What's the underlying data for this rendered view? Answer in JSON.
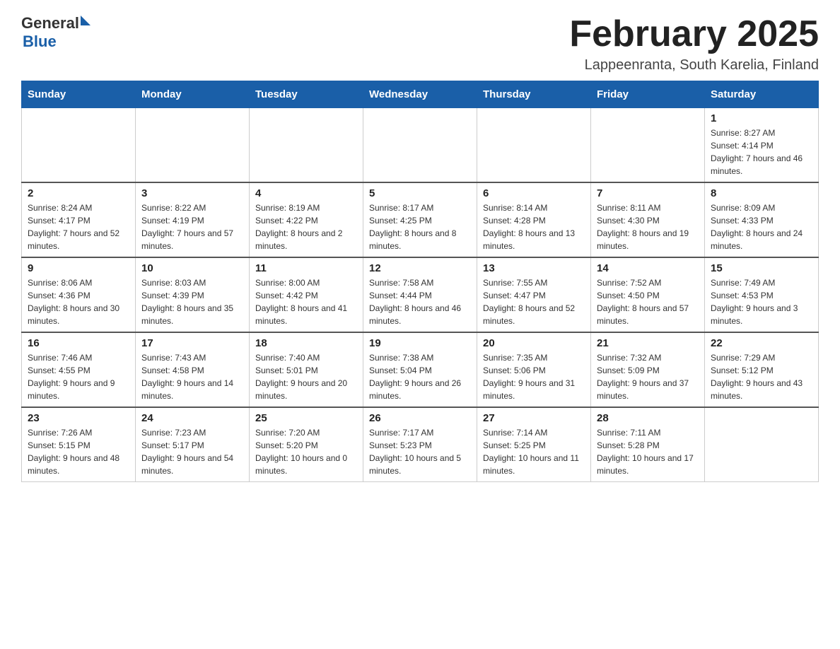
{
  "header": {
    "logo_text1": "General",
    "logo_text2": "Blue",
    "month_title": "February 2025",
    "location": "Lappeenranta, South Karelia, Finland"
  },
  "weekdays": [
    "Sunday",
    "Monday",
    "Tuesday",
    "Wednesday",
    "Thursday",
    "Friday",
    "Saturday"
  ],
  "weeks": [
    [
      {
        "day": "",
        "info": ""
      },
      {
        "day": "",
        "info": ""
      },
      {
        "day": "",
        "info": ""
      },
      {
        "day": "",
        "info": ""
      },
      {
        "day": "",
        "info": ""
      },
      {
        "day": "",
        "info": ""
      },
      {
        "day": "1",
        "info": "Sunrise: 8:27 AM\nSunset: 4:14 PM\nDaylight: 7 hours and 46 minutes."
      }
    ],
    [
      {
        "day": "2",
        "info": "Sunrise: 8:24 AM\nSunset: 4:17 PM\nDaylight: 7 hours and 52 minutes."
      },
      {
        "day": "3",
        "info": "Sunrise: 8:22 AM\nSunset: 4:19 PM\nDaylight: 7 hours and 57 minutes."
      },
      {
        "day": "4",
        "info": "Sunrise: 8:19 AM\nSunset: 4:22 PM\nDaylight: 8 hours and 2 minutes."
      },
      {
        "day": "5",
        "info": "Sunrise: 8:17 AM\nSunset: 4:25 PM\nDaylight: 8 hours and 8 minutes."
      },
      {
        "day": "6",
        "info": "Sunrise: 8:14 AM\nSunset: 4:28 PM\nDaylight: 8 hours and 13 minutes."
      },
      {
        "day": "7",
        "info": "Sunrise: 8:11 AM\nSunset: 4:30 PM\nDaylight: 8 hours and 19 minutes."
      },
      {
        "day": "8",
        "info": "Sunrise: 8:09 AM\nSunset: 4:33 PM\nDaylight: 8 hours and 24 minutes."
      }
    ],
    [
      {
        "day": "9",
        "info": "Sunrise: 8:06 AM\nSunset: 4:36 PM\nDaylight: 8 hours and 30 minutes."
      },
      {
        "day": "10",
        "info": "Sunrise: 8:03 AM\nSunset: 4:39 PM\nDaylight: 8 hours and 35 minutes."
      },
      {
        "day": "11",
        "info": "Sunrise: 8:00 AM\nSunset: 4:42 PM\nDaylight: 8 hours and 41 minutes."
      },
      {
        "day": "12",
        "info": "Sunrise: 7:58 AM\nSunset: 4:44 PM\nDaylight: 8 hours and 46 minutes."
      },
      {
        "day": "13",
        "info": "Sunrise: 7:55 AM\nSunset: 4:47 PM\nDaylight: 8 hours and 52 minutes."
      },
      {
        "day": "14",
        "info": "Sunrise: 7:52 AM\nSunset: 4:50 PM\nDaylight: 8 hours and 57 minutes."
      },
      {
        "day": "15",
        "info": "Sunrise: 7:49 AM\nSunset: 4:53 PM\nDaylight: 9 hours and 3 minutes."
      }
    ],
    [
      {
        "day": "16",
        "info": "Sunrise: 7:46 AM\nSunset: 4:55 PM\nDaylight: 9 hours and 9 minutes."
      },
      {
        "day": "17",
        "info": "Sunrise: 7:43 AM\nSunset: 4:58 PM\nDaylight: 9 hours and 14 minutes."
      },
      {
        "day": "18",
        "info": "Sunrise: 7:40 AM\nSunset: 5:01 PM\nDaylight: 9 hours and 20 minutes."
      },
      {
        "day": "19",
        "info": "Sunrise: 7:38 AM\nSunset: 5:04 PM\nDaylight: 9 hours and 26 minutes."
      },
      {
        "day": "20",
        "info": "Sunrise: 7:35 AM\nSunset: 5:06 PM\nDaylight: 9 hours and 31 minutes."
      },
      {
        "day": "21",
        "info": "Sunrise: 7:32 AM\nSunset: 5:09 PM\nDaylight: 9 hours and 37 minutes."
      },
      {
        "day": "22",
        "info": "Sunrise: 7:29 AM\nSunset: 5:12 PM\nDaylight: 9 hours and 43 minutes."
      }
    ],
    [
      {
        "day": "23",
        "info": "Sunrise: 7:26 AM\nSunset: 5:15 PM\nDaylight: 9 hours and 48 minutes."
      },
      {
        "day": "24",
        "info": "Sunrise: 7:23 AM\nSunset: 5:17 PM\nDaylight: 9 hours and 54 minutes."
      },
      {
        "day": "25",
        "info": "Sunrise: 7:20 AM\nSunset: 5:20 PM\nDaylight: 10 hours and 0 minutes."
      },
      {
        "day": "26",
        "info": "Sunrise: 7:17 AM\nSunset: 5:23 PM\nDaylight: 10 hours and 5 minutes."
      },
      {
        "day": "27",
        "info": "Sunrise: 7:14 AM\nSunset: 5:25 PM\nDaylight: 10 hours and 11 minutes."
      },
      {
        "day": "28",
        "info": "Sunrise: 7:11 AM\nSunset: 5:28 PM\nDaylight: 10 hours and 17 minutes."
      },
      {
        "day": "",
        "info": ""
      }
    ]
  ]
}
